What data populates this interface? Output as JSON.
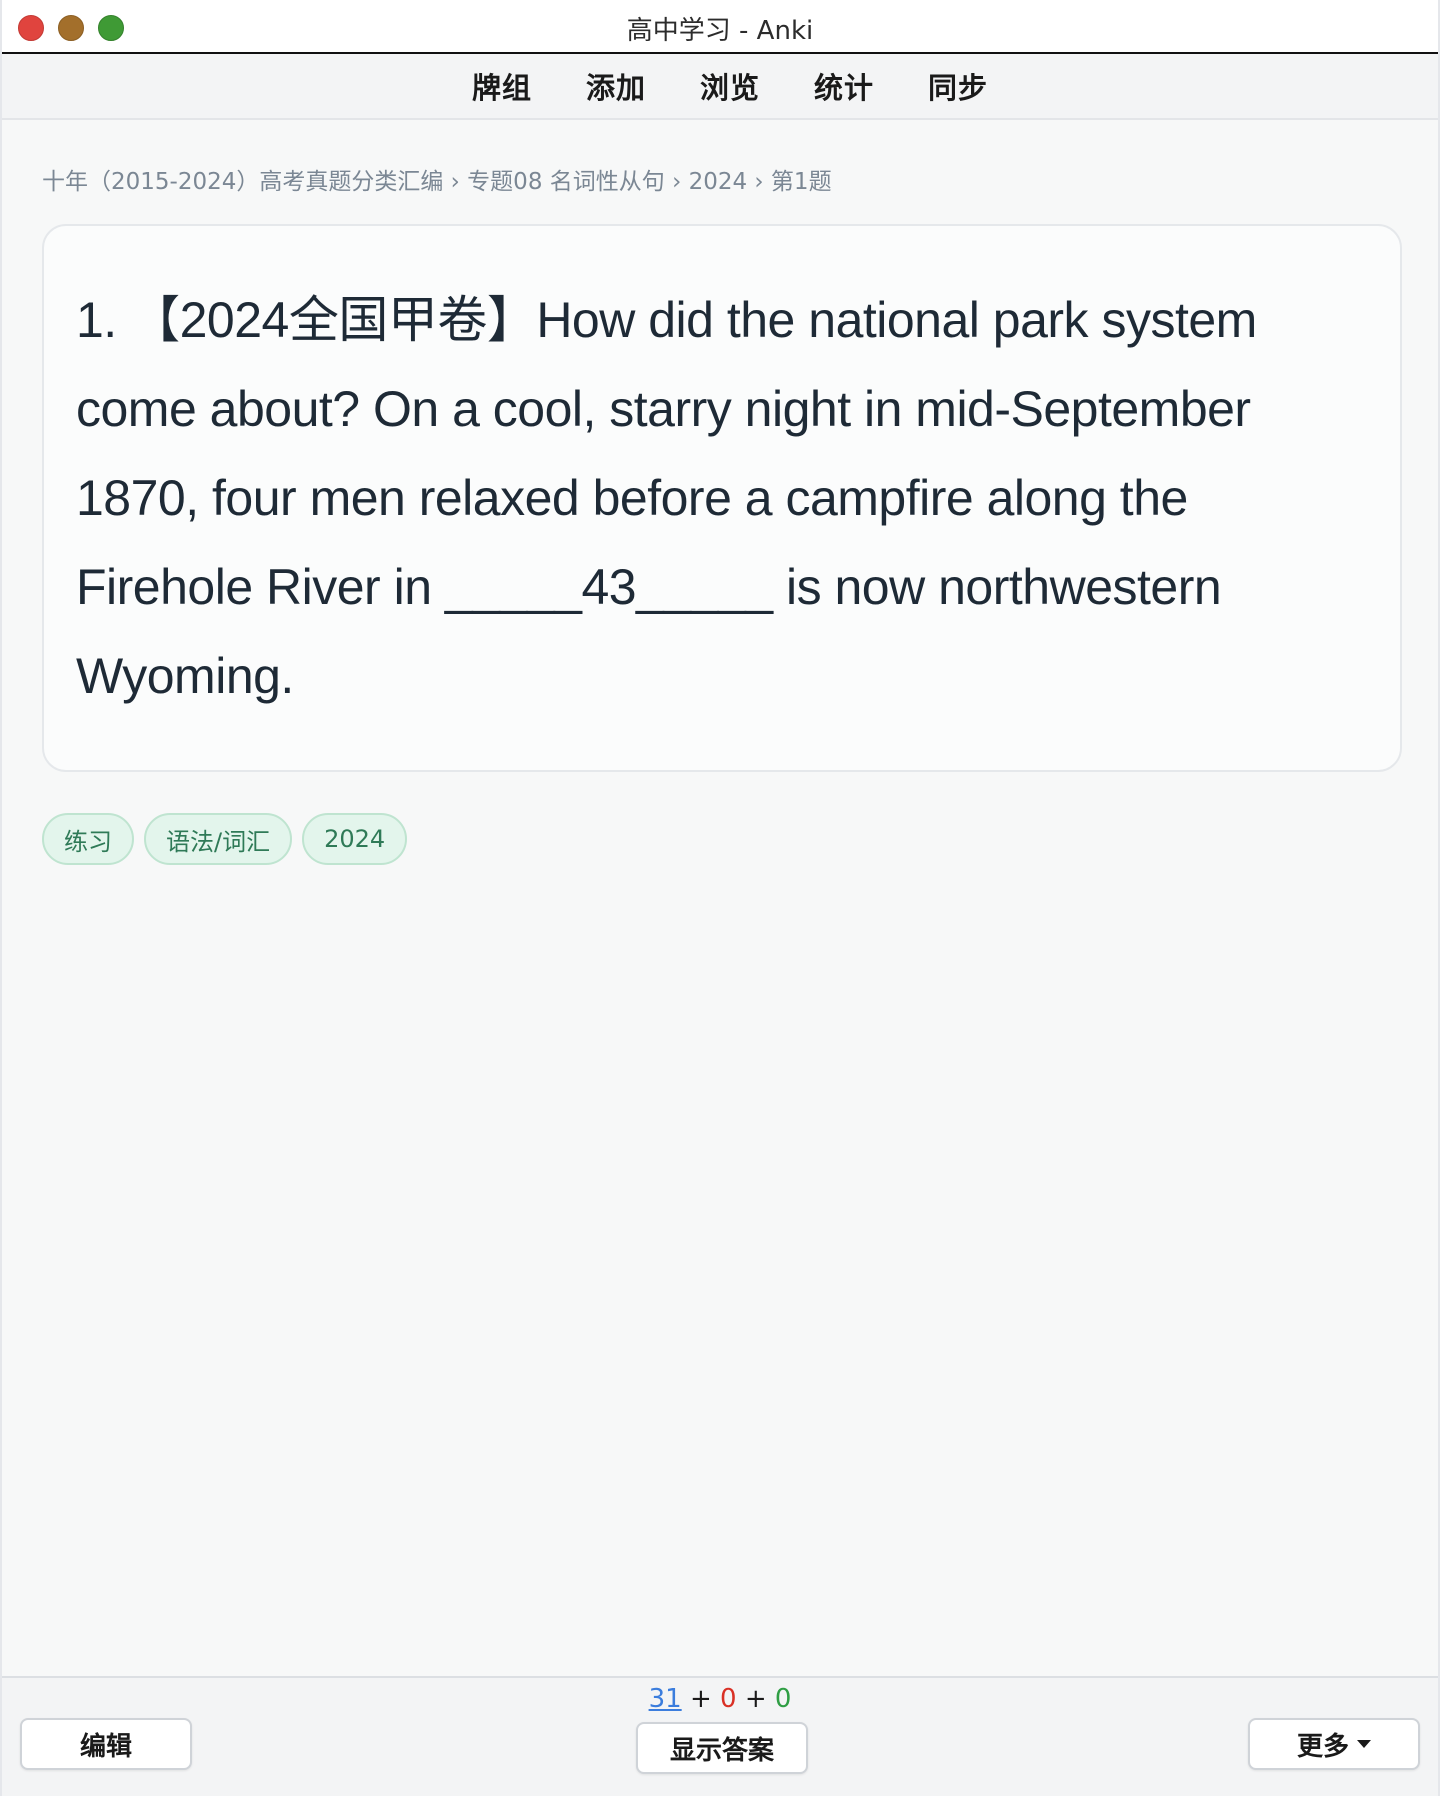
{
  "window": {
    "title": "高中学习 - Anki"
  },
  "nav": {
    "items": [
      "牌组",
      "添加",
      "浏览",
      "统计",
      "同步"
    ]
  },
  "breadcrumb": "十年（2015-2024）高考真题分类汇编 › 专题08 名词性从句 › 2024 › 第1题",
  "card": {
    "prefix": "1. 【2024全国甲卷】",
    "text_before_blank": "How did the national park system come about? On a cool, starry night in mid-September 1870, four men relaxed before a campfire along the Firehole River in ",
    "blank": "_____43_____",
    "text_after_blank": " is now northwestern Wyoming."
  },
  "tags": [
    "练习",
    "语法/词汇",
    "2024"
  ],
  "bottom": {
    "edit_label": "编辑",
    "show_answer_label": "显示答案",
    "more_label": "更多",
    "counts": {
      "new": "31",
      "learning": "0",
      "review": "0",
      "plus": "+"
    }
  },
  "colors": {
    "new": "#3b7ddd",
    "learning": "#d93025",
    "review": "#2f9e44",
    "tag_bg": "#e3f5ec",
    "tag_text": "#2f7a57"
  },
  "icons": {
    "more_dropdown": "caret-down-icon"
  }
}
